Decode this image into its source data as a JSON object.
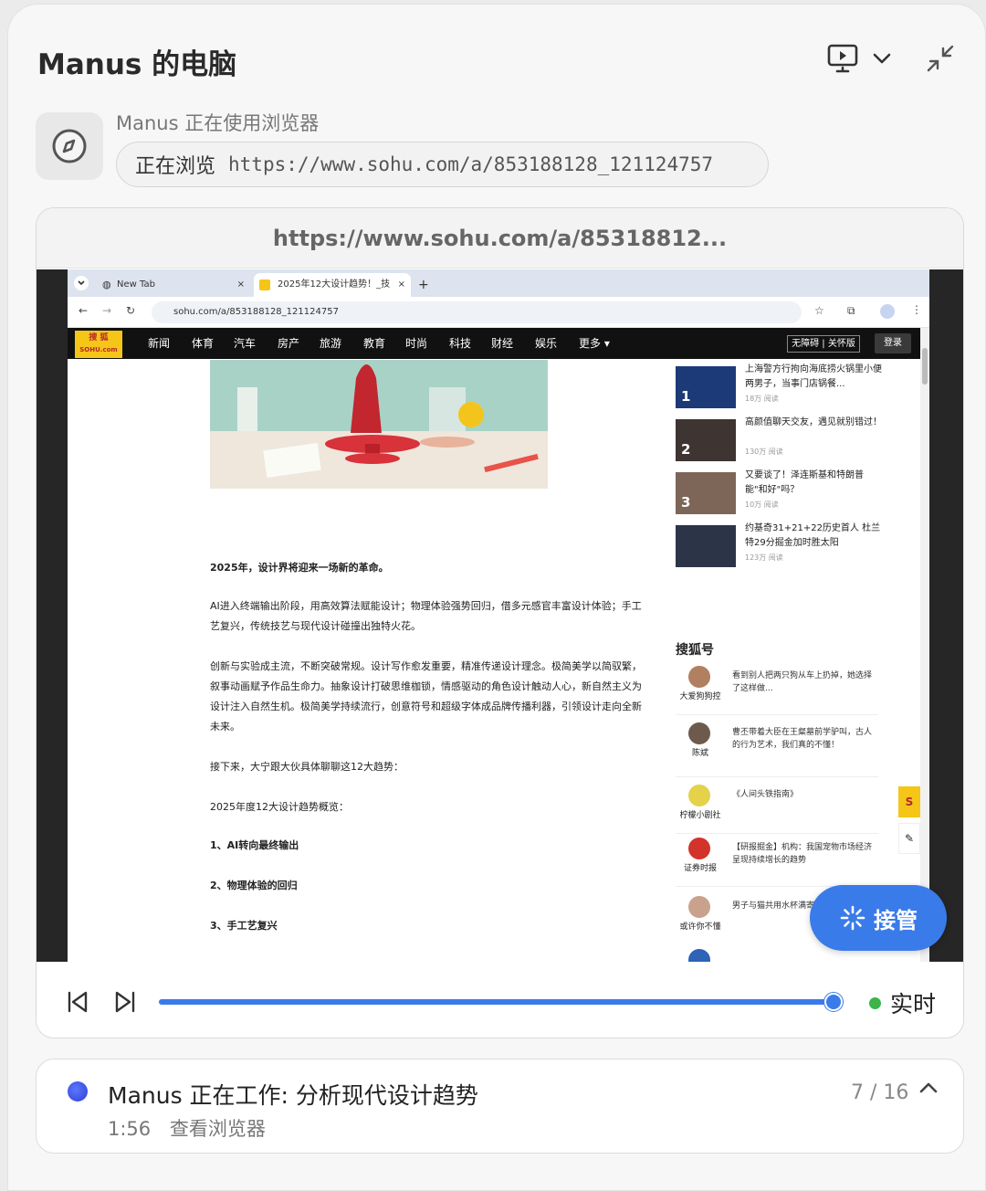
{
  "header": {
    "title": "Manus 的电脑"
  },
  "activity": {
    "using_label": "Manus 正在使用浏览器",
    "browsing_label": "正在浏览",
    "browsing_url": "https://www.sohu.com/a/853188128_121124757"
  },
  "viewer": {
    "url": "https://www.sohu.com/a/85318812...",
    "live_label": "实时",
    "progress": 0.99,
    "takeover_label": "接管"
  },
  "browser": {
    "tabs": [
      {
        "label": "New Tab",
        "active": false
      },
      {
        "label": "2025年12大设计趋势！_技",
        "active": true
      }
    ],
    "address": "sohu.com/a/853188128_121124757",
    "site": {
      "logo_top": "搜 狐",
      "logo_bottom": "SOHU.com",
      "nav": [
        "新闻",
        "体育",
        "汽车",
        "房产",
        "旅游",
        "教育",
        "时尚",
        "科技",
        "财经",
        "娱乐",
        "更多 ▾"
      ],
      "accessibility": "无障碍 | 关怀版",
      "login": "登录"
    },
    "article": {
      "lead": "2025年，设计界将迎来一场新的革命。",
      "p1": "AI进入终端输出阶段，用高效算法赋能设计；物理体验强势回归，借多元感官丰富设计体验；手工艺复兴，传统技艺与现代设计碰撞出独特火花。",
      "p2": "创新与实验成主流，不断突破常规。设计写作愈发重要，精准传递设计理念。极简美学以简驭繁，叙事动画赋予作品生命力。抽象设计打破思维枷锁，情感驱动的角色设计触动人心，新自然主义为设计注入自然生机。极简美学持续流行，创意符号和超级字体成品牌传播利器，引领设计走向全新未来。",
      "p3": "接下来，大宁跟大伙具体聊聊这12大趋势：",
      "p4": "2025年度12大设计趋势概览：",
      "items": [
        "1、AI转向最终输出",
        "2、物理体验的回归",
        "3、手工艺复兴"
      ]
    },
    "ranking": [
      {
        "num": "1",
        "title": "上海警方行拘向海底捞火锅里小便两男子，当事门店锅餐...",
        "reads": "18万 阅读"
      },
      {
        "num": "2",
        "title": "高颜值聊天交友，遇见就别错过！",
        "reads": "130万 阅读"
      },
      {
        "num": "3",
        "title": "又要谈了！泽连斯基和特朗普能\"和好\"吗？",
        "reads": "10万 阅读"
      },
      {
        "num": "",
        "title": "约基奇31+21+22历史首人 杜兰特29分掘金加时胜太阳",
        "reads": "123万 阅读"
      }
    ],
    "sohu_hao": {
      "heading": "搜狐号",
      "items": [
        {
          "name": "大爱狗狗控",
          "text": "看到别人把两只狗从车上扔掉，她选择了这样做..."
        },
        {
          "name": "陈斌",
          "text": "曹丕带着大臣在王粲墓前学驴叫，古人的行为艺术，我们真的不懂！"
        },
        {
          "name": "柠檬小剧社",
          "text": "《人间头铁指南》"
        },
        {
          "name": "证券时报",
          "text": "【研报掘金】机构：我国宠物市场经济呈现持续增长的趋势"
        },
        {
          "name": "或许你不懂",
          "text": "男子与猫共用水杯满寄生虫险些丧命"
        }
      ]
    }
  },
  "status": {
    "title": "Manus 正在工作: 分析现代设计趋势",
    "time": "1:56",
    "view_browser": "查看浏览器",
    "step": "7 / 16"
  },
  "colors": {
    "accent": "#3a7bea",
    "live": "#3bb54a"
  }
}
